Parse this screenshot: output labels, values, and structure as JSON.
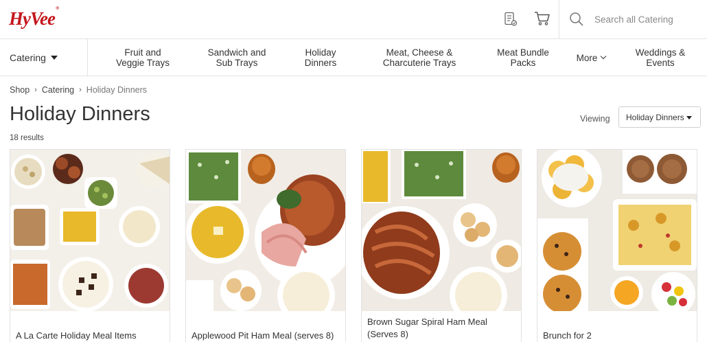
{
  "header": {
    "logo_text": "HyVee",
    "logo_mark": "®",
    "search_placeholder": "Search all Catering",
    "icons": [
      "list-icon",
      "cart-icon",
      "search-icon"
    ],
    "brand_color": "#c4151c"
  },
  "nav": {
    "catering_label": "Catering",
    "items": [
      {
        "line1": "Fruit and",
        "line2": "Veggie Trays"
      },
      {
        "line1": "Sandwich and",
        "line2": "Sub Trays"
      },
      {
        "line1": "Holiday",
        "line2": "Dinners"
      },
      {
        "line1": "Meat, Cheese &",
        "line2": "Charcuterie Trays"
      },
      {
        "line1": "Meat Bundle",
        "line2": "Packs"
      },
      {
        "line1": "More",
        "line2": ""
      },
      {
        "line1": "Weddings &",
        "line2": "Events"
      }
    ]
  },
  "breadcrumb": [
    "Shop",
    "Catering",
    "Holiday Dinners"
  ],
  "page": {
    "title": "Holiday Dinners",
    "results": "18 results",
    "viewing_label": "Viewing",
    "viewing_value": "Holiday Dinners"
  },
  "products": [
    {
      "title": "A La Carte Holiday Meal Items"
    },
    {
      "title": "Applewood Pit Ham Meal (serves 8)"
    },
    {
      "title": "Brown Sugar Spiral Ham Meal (Serves 8)"
    },
    {
      "title": "Brunch for 2"
    }
  ]
}
